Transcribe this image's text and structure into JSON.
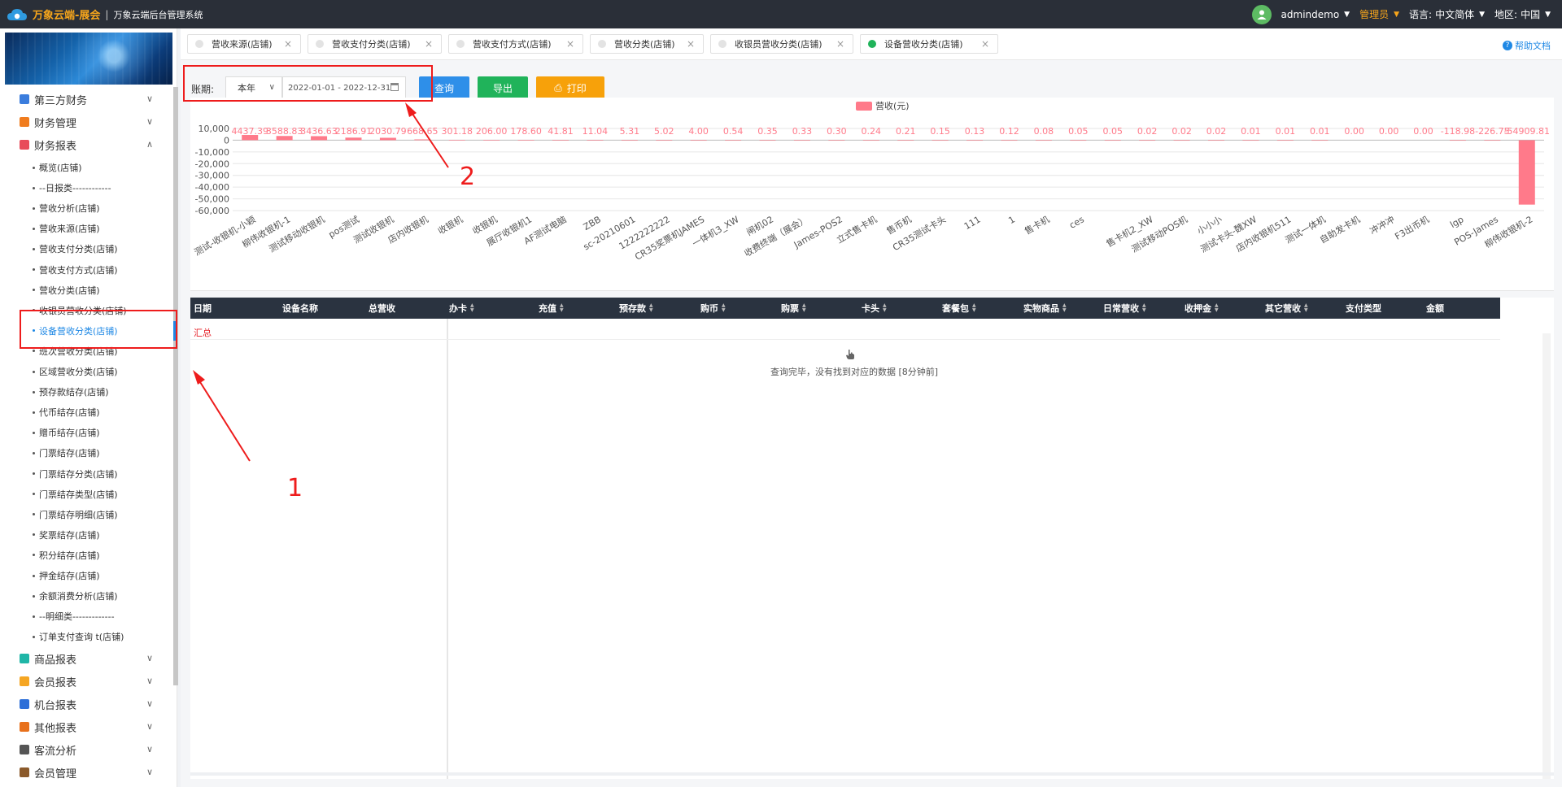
{
  "header": {
    "brand": "万象云端-展会",
    "separator": "|",
    "subtitle": "万象云端后台管理系统",
    "username": "admindemo",
    "role": "管理员",
    "language_label": "语言:",
    "language_value": "中文简体",
    "region_label": "地区:",
    "region_value": "中国"
  },
  "sidebar": {
    "groups": [
      {
        "label": "第三方财务",
        "icon_color": "#3b7ddd"
      },
      {
        "label": "财务管理",
        "icon_color": "#f07c1e"
      },
      {
        "label": "财务报表",
        "icon_color": "#e84c5a"
      }
    ],
    "subitems": [
      "概览(店铺)",
      "--日报类------------",
      "营收分析(店铺)",
      "营收来源(店铺)",
      "营收支付分类(店铺)",
      "营收支付方式(店铺)",
      "营收分类(店铺)",
      "收银员营收分类(店铺)",
      "设备营收分类(店铺)",
      "班次营收分类(店铺)",
      "区域营收分类(店铺)",
      "预存款结存(店铺)",
      "代币结存(店铺)",
      "赠币结存(店铺)",
      "门票结存(店铺)",
      "门票结存分类(店铺)",
      "门票结存类型(店铺)",
      "门票结存明细(店铺)",
      "奖票结存(店铺)",
      "积分结存(店铺)",
      "押金结存(店铺)",
      "余额消费分析(店铺)",
      "--明细类-------------",
      "订单支付查询 t(店铺)"
    ],
    "active_subitem": "设备营收分类(店铺)",
    "bottom_groups": [
      {
        "label": "商品报表",
        "icon_color": "#1fb6a7"
      },
      {
        "label": "会员报表",
        "icon_color": "#f5a623"
      },
      {
        "label": "机台报表",
        "icon_color": "#2d6fd8"
      },
      {
        "label": "其他报表",
        "icon_color": "#e8711c"
      },
      {
        "label": "客流分析",
        "icon_color": "#555555"
      },
      {
        "label": "会员管理",
        "icon_color": "#8b5a2b"
      }
    ]
  },
  "tabs": [
    {
      "label": "营收来源(店铺)",
      "active": false
    },
    {
      "label": "营收支付分类(店铺)",
      "active": false
    },
    {
      "label": "营收支付方式(店铺)",
      "active": false
    },
    {
      "label": "营收分类(店铺)",
      "active": false
    },
    {
      "label": "收银员营收分类(店铺)",
      "active": false
    },
    {
      "label": "设备营收分类(店铺)",
      "active": true
    }
  ],
  "tab_close": "×",
  "help": {
    "icon": "?",
    "label": "帮助文档"
  },
  "filters": {
    "period_label": "账期:",
    "period_select": "本年",
    "date_range": "2022-01-01 - 2022-12-31",
    "query_button": "查询",
    "export_button": "导出",
    "print_button": "打印"
  },
  "chart_data": {
    "type": "bar",
    "legend": [
      "营收(元)"
    ],
    "legend_position": "top-center",
    "series_color": "#ff7a8a",
    "ylim": [
      -60000,
      10000
    ],
    "yticks": [
      "10,000",
      "0",
      "-10,000",
      "-20,000",
      "-30,000",
      "-40,000",
      "-50,000",
      "-60,000"
    ],
    "categories": [
      "测试-收银机-小颖",
      "柳伟收银机-1",
      "测试移动收银机",
      "pos测试",
      "测试收银机",
      "店内收银机",
      "收银机",
      "收银机",
      "展厅收银机1",
      "AF测试电脑",
      "ZBB",
      "sc-20210601",
      "1222222222",
      "CR35奖票机JAMES",
      "一体机3_XW",
      "闸机02",
      "收费终端（展会）",
      "James-POS2",
      "立式售卡机",
      "售币机",
      "CR35测试卡头",
      "111",
      "1",
      "售卡机",
      "ces",
      "",
      "售卡机2_XW",
      "测试移动POS机",
      "小小小",
      "测试卡头-魏XW",
      "店内收银机511",
      "测试一体机",
      "自助发卡机",
      "冲冲冲",
      "F3出币机",
      "lgp",
      "POS-James",
      "柳伟收银机-2"
    ],
    "values": [
      4437.39,
      3588.83,
      3436.63,
      2186.91,
      2030.79,
      668.65,
      301.18,
      206.0,
      178.6,
      41.81,
      11.04,
      5.31,
      5.02,
      4.0,
      0.54,
      0.35,
      0.33,
      0.3,
      0.24,
      0.21,
      0.15,
      0.13,
      0.12,
      0.08,
      0.05,
      0.05,
      0.02,
      0.02,
      0.02,
      0.01,
      0.01,
      0.01,
      0.0,
      0.0,
      0.0,
      -118.98,
      -226.75,
      -54909.81
    ],
    "value_labels": [
      "4437.39",
      "3588.83",
      "3436.63",
      "2186.91",
      "2030.79",
      "668.65",
      "301.18",
      "206.00",
      "178.60",
      "41.81",
      "11.04",
      "5.31",
      "5.02",
      "4.00",
      "0.54",
      "0.35",
      "0.33",
      "0.30",
      "0.24",
      "0.21",
      "0.15",
      "0.13",
      "0.12",
      "0.08",
      "0.05",
      "0.05",
      "0.02",
      "0.02",
      "0.02",
      "0.01",
      "0.01",
      "0.01",
      "0.00",
      "0.00",
      "0.00",
      "-118.98",
      "-226.75",
      "-54909.81"
    ]
  },
  "table": {
    "columns": [
      {
        "label": "日期",
        "sortable": false
      },
      {
        "label": "设备名称",
        "sortable": false
      },
      {
        "label": "总营收",
        "sortable": false
      },
      {
        "label": "办卡",
        "sortable": true
      },
      {
        "label": "充值",
        "sortable": true
      },
      {
        "label": "预存款",
        "sortable": true
      },
      {
        "label": "购币",
        "sortable": true
      },
      {
        "label": "购票",
        "sortable": true
      },
      {
        "label": "卡头",
        "sortable": true
      },
      {
        "label": "套餐包",
        "sortable": true
      },
      {
        "label": "实物商品",
        "sortable": true
      },
      {
        "label": "日常营收",
        "sortable": true
      },
      {
        "label": "收押金",
        "sortable": true
      },
      {
        "label": "其它营收",
        "sortable": true
      },
      {
        "label": "支付类型",
        "sortable": false
      },
      {
        "label": "金额",
        "sortable": false
      }
    ],
    "summary_label": "汇总",
    "empty_message": "查询完毕，没有找到对应的数据 [8分钟前]"
  },
  "annotations": {
    "label_1": "1",
    "label_2": "2",
    "color": "#ee1c1c"
  }
}
